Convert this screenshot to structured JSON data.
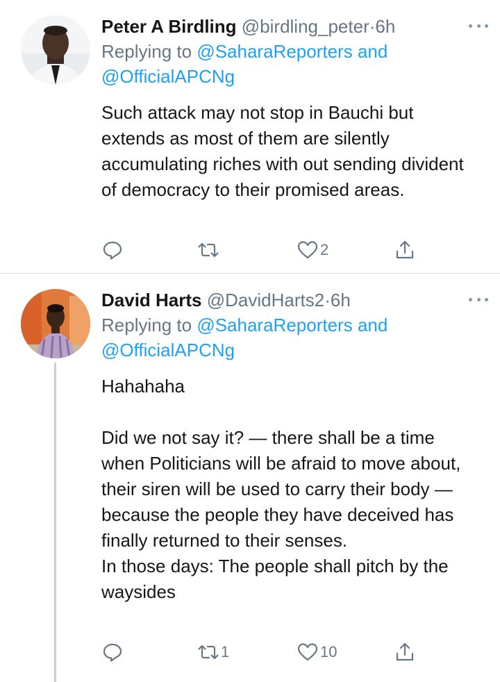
{
  "colors": {
    "link": "#1da1f2",
    "secondary_text": "#657786",
    "primary_text": "#14171a",
    "divider": "#d6dbdf"
  },
  "tweets": [
    {
      "author_name": "Peter A Birdling",
      "handle": "@birdling_peter",
      "separator": "·",
      "time": "6h",
      "replying_prefix": "Replying to",
      "reply_to_1": "@SaharaReporters",
      "reply_and": "and",
      "reply_to_2": "@OfficialAPCNg",
      "text": "Such attack may not stop in Bauchi but extends as most of them are silently accumulating riches with out sending divident of democracy to their promised areas.",
      "reply_count": "",
      "retweet_count": "",
      "like_count": "2",
      "icons": [
        "reply-icon",
        "retweet-icon",
        "heart-icon",
        "share-icon"
      ]
    },
    {
      "author_name": "David Harts",
      "handle": "@DavidHarts2",
      "separator": "·",
      "time": "6h",
      "replying_prefix": "Replying to",
      "reply_to_1": "@SaharaReporters",
      "reply_and": "and",
      "reply_to_2": "@OfficialAPCNg",
      "text": "Hahahaha\n\nDid we not say it? — there shall be a time when Politicians will be afraid to move about, their siren will be used to carry their body — because the people they have deceived has finally returned to their senses.\nIn those days: The people shall pitch by the waysides",
      "reply_count": "",
      "retweet_count": "1",
      "like_count": "10",
      "icons": [
        "reply-icon",
        "retweet-icon",
        "heart-icon",
        "share-icon"
      ]
    }
  ]
}
